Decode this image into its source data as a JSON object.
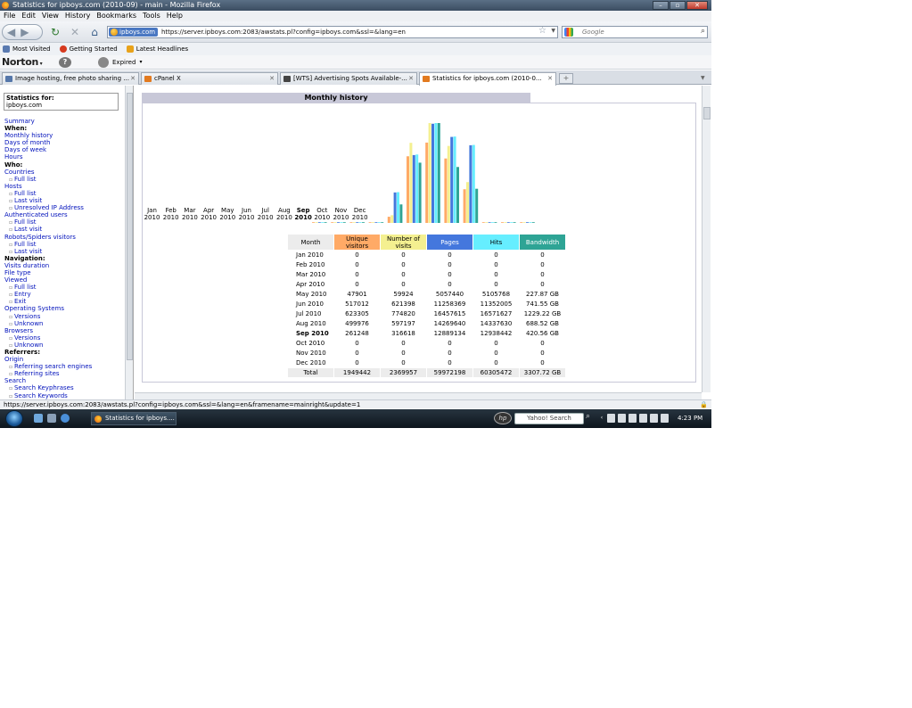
{
  "window": {
    "title": "Statistics for ipboys.com (2010-09) - main - Mozilla Firefox"
  },
  "menu": [
    "File",
    "Edit",
    "View",
    "History",
    "Bookmarks",
    "Tools",
    "Help"
  ],
  "nav": {
    "site_badge": "ipboys.com",
    "url": "https://server.ipboys.com:2083/awstats.pl?config=ipboys.com&ssl=&lang=en",
    "search_placeholder": "Google"
  },
  "bookmarks": [
    {
      "label": "Most Visited",
      "color": "#5a7ab0"
    },
    {
      "label": "Getting Started",
      "color": "#d63a1f"
    },
    {
      "label": "Latest Headlines",
      "color": "#e8a21a"
    }
  ],
  "norton": {
    "logo": "Norton",
    "help": "?",
    "status": "Expired"
  },
  "tabs": [
    {
      "label": "Image hosting, free photo sharing ...",
      "icon_color": "#5577aa",
      "active": false
    },
    {
      "label": "cPanel X",
      "icon_color": "#e27a1f",
      "active": false
    },
    {
      "label": "[WTS] Advertising Spots Available-...",
      "icon_color": "#444444",
      "active": false
    },
    {
      "label": "Statistics for ipboys.com (2010-0...",
      "icon_color": "#e27a1f",
      "active": true
    }
  ],
  "left_panel": {
    "stats_for_label": "Statistics for:",
    "domain": "ipboys.com",
    "menu": [
      {
        "type": "lnk",
        "label": "Summary"
      },
      {
        "type": "hdr",
        "label": "When:"
      },
      {
        "type": "lnk",
        "label": "Monthly history"
      },
      {
        "type": "lnk",
        "label": "Days of month"
      },
      {
        "type": "lnk",
        "label": "Days of week"
      },
      {
        "type": "lnk",
        "label": "Hours"
      },
      {
        "type": "hdr",
        "label": "Who:"
      },
      {
        "type": "lnk",
        "label": "Countries"
      },
      {
        "type": "sub",
        "label": "Full list"
      },
      {
        "type": "lnk",
        "label": "Hosts"
      },
      {
        "type": "sub",
        "label": "Full list"
      },
      {
        "type": "sub",
        "label": "Last visit"
      },
      {
        "type": "sub",
        "label": "Unresolved IP Address"
      },
      {
        "type": "lnk",
        "label": "Authenticated users"
      },
      {
        "type": "sub",
        "label": "Full list"
      },
      {
        "type": "sub",
        "label": "Last visit"
      },
      {
        "type": "lnk",
        "label": "Robots/Spiders visitors"
      },
      {
        "type": "sub",
        "label": "Full list"
      },
      {
        "type": "sub",
        "label": "Last visit"
      },
      {
        "type": "hdr",
        "label": "Navigation:"
      },
      {
        "type": "lnk",
        "label": "Visits duration"
      },
      {
        "type": "lnk",
        "label": "File type"
      },
      {
        "type": "lnk",
        "label": "Viewed"
      },
      {
        "type": "sub",
        "label": "Full list"
      },
      {
        "type": "sub",
        "label": "Entry"
      },
      {
        "type": "sub",
        "label": "Exit"
      },
      {
        "type": "lnk",
        "label": "Operating Systems"
      },
      {
        "type": "sub",
        "label": "Versions"
      },
      {
        "type": "sub",
        "label": "Unknown"
      },
      {
        "type": "lnk",
        "label": "Browsers"
      },
      {
        "type": "sub",
        "label": "Versions"
      },
      {
        "type": "sub",
        "label": "Unknown"
      },
      {
        "type": "hdr",
        "label": "Referrers:"
      },
      {
        "type": "lnk",
        "label": "Origin"
      },
      {
        "type": "sub",
        "label": "Referring search engines"
      },
      {
        "type": "sub",
        "label": "Referring sites"
      },
      {
        "type": "lnk",
        "label": "Search"
      },
      {
        "type": "sub",
        "label": "Search Keyphrases"
      },
      {
        "type": "sub",
        "label": "Search Keywords"
      }
    ]
  },
  "main": {
    "section_title": "Monthly history",
    "columns": [
      "Month",
      "Unique visitors",
      "Number of visits",
      "Pages",
      "Hits",
      "Bandwidth"
    ],
    "rows": [
      {
        "month": "Jan 2010",
        "uv": "0",
        "nv": "0",
        "pages": "0",
        "hits": "0",
        "bw": "0"
      },
      {
        "month": "Feb 2010",
        "uv": "0",
        "nv": "0",
        "pages": "0",
        "hits": "0",
        "bw": "0"
      },
      {
        "month": "Mar 2010",
        "uv": "0",
        "nv": "0",
        "pages": "0",
        "hits": "0",
        "bw": "0"
      },
      {
        "month": "Apr 2010",
        "uv": "0",
        "nv": "0",
        "pages": "0",
        "hits": "0",
        "bw": "0"
      },
      {
        "month": "May 2010",
        "uv": "47901",
        "nv": "59924",
        "pages": "5057440",
        "hits": "5105768",
        "bw": "227.87 GB"
      },
      {
        "month": "Jun 2010",
        "uv": "517012",
        "nv": "621398",
        "pages": "11258369",
        "hits": "11352005",
        "bw": "741.55 GB"
      },
      {
        "month": "Jul 2010",
        "uv": "623305",
        "nv": "774820",
        "pages": "16457615",
        "hits": "16571627",
        "bw": "1229.22 GB"
      },
      {
        "month": "Aug 2010",
        "uv": "499976",
        "nv": "597197",
        "pages": "14269640",
        "hits": "14337630",
        "bw": "688.52 GB"
      },
      {
        "month": "Sep 2010",
        "uv": "261248",
        "nv": "316618",
        "pages": "12889134",
        "hits": "12938442",
        "bw": "420.56 GB",
        "current": true
      },
      {
        "month": "Oct 2010",
        "uv": "0",
        "nv": "0",
        "pages": "0",
        "hits": "0",
        "bw": "0"
      },
      {
        "month": "Nov 2010",
        "uv": "0",
        "nv": "0",
        "pages": "0",
        "hits": "0",
        "bw": "0"
      },
      {
        "month": "Dec 2010",
        "uv": "0",
        "nv": "0",
        "pages": "0",
        "hits": "0",
        "bw": "0"
      }
    ],
    "total": {
      "month": "Total",
      "uv": "1949442",
      "nv": "2369957",
      "pages": "59972198",
      "hits": "60305472",
      "bw": "3307.72 GB"
    }
  },
  "chart_data": {
    "type": "bar",
    "categories": [
      "Jan 2010",
      "Feb 2010",
      "Mar 2010",
      "Apr 2010",
      "May 2010",
      "Jun 2010",
      "Jul 2010",
      "Aug 2010",
      "Sep 2010",
      "Oct 2010",
      "Nov 2010",
      "Dec 2010"
    ],
    "month_labels": [
      "Jan",
      "Feb",
      "Mar",
      "Apr",
      "May",
      "Jun",
      "Jul",
      "Aug",
      "Sep",
      "Oct",
      "Nov",
      "Dec"
    ],
    "year_label": "2010",
    "current_index": 8,
    "series": [
      {
        "key": "uv",
        "color": "#ffaa66",
        "values": [
          0,
          0,
          0,
          0,
          47901,
          517012,
          623305,
          499976,
          261248,
          0,
          0,
          0
        ]
      },
      {
        "key": "nv",
        "color": "#f4f090",
        "values": [
          0,
          0,
          0,
          0,
          59924,
          621398,
          774820,
          597197,
          316618,
          0,
          0,
          0
        ]
      },
      {
        "key": "pages",
        "color": "#4477dd",
        "values": [
          0,
          0,
          0,
          0,
          5057440,
          11258369,
          16457615,
          14269640,
          12889134,
          0,
          0,
          0
        ]
      },
      {
        "key": "hits",
        "color": "#66eeff",
        "values": [
          0,
          0,
          0,
          0,
          5105768,
          11352005,
          16571627,
          14337630,
          12938442,
          0,
          0,
          0
        ]
      },
      {
        "key": "bw",
        "color": "#2ea495",
        "values": [
          0,
          0,
          0,
          0,
          227.87,
          741.55,
          1229.22,
          688.52,
          420.56,
          0,
          0,
          0
        ]
      }
    ],
    "scale_groups": {
      "uv": "visitors",
      "nv": "visitors",
      "pages": "hits",
      "hits": "hits",
      "bw": "bw"
    }
  },
  "statusbar": {
    "text": "https://server.ipboys.com:2083/awstats.pl?config=ipboys.com&ssl=&lang=en&framename=mainright&update=1"
  },
  "taskbar": {
    "firefox_task": "Statistics for ipboys....",
    "hp_label": "hp",
    "yahoo_search": "Yahoo! Search",
    "clock": "4:23 PM"
  }
}
